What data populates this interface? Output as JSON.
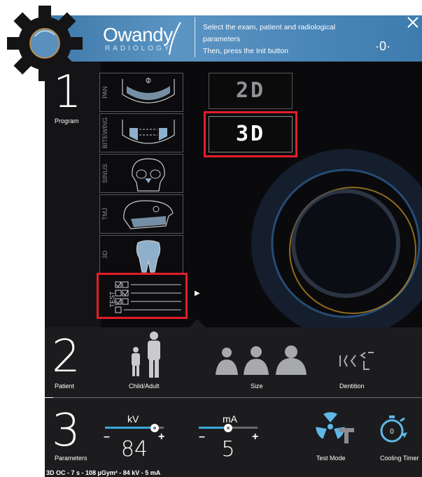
{
  "header": {
    "brand": "Owandy",
    "brand_sub": "RADIOLOGY",
    "instructions": [
      "Select the exam, patient and radiological",
      "parameters",
      "Then, press the Init button"
    ],
    "zero_symbol": "·0·"
  },
  "program": {
    "number": "1",
    "label": "Program",
    "items": [
      {
        "label": "PAN"
      },
      {
        "label": "BITEWING"
      },
      {
        "label": "SINUS"
      },
      {
        "label": "TMJ"
      },
      {
        "label": "3D"
      },
      {
        "label": "TEST"
      }
    ],
    "modes": [
      {
        "label": "2D",
        "selected": false
      },
      {
        "label": "3D",
        "selected": true
      }
    ]
  },
  "patient": {
    "number": "2",
    "label": "Patient",
    "options": [
      {
        "label": "Child/Adult"
      },
      {
        "label": "Size"
      },
      {
        "label": "Dentition"
      }
    ]
  },
  "parameters": {
    "number": "3",
    "label": "Parameters",
    "kv": {
      "label": "kV",
      "value": "84",
      "level": 0.85
    },
    "ma": {
      "label": "mA",
      "value": "5",
      "level": 0.5
    },
    "test_mode_label": "Test Mode",
    "cooling_timer_label": "Cooling Timer",
    "cooling_value": "0"
  },
  "summary": "3D OC - 7 s - 108 µGym² - 84 kV - 5 mA",
  "colors": {
    "accent": "#3aa8e0",
    "selection": "#e21d2b",
    "header": "#4a86b8"
  }
}
